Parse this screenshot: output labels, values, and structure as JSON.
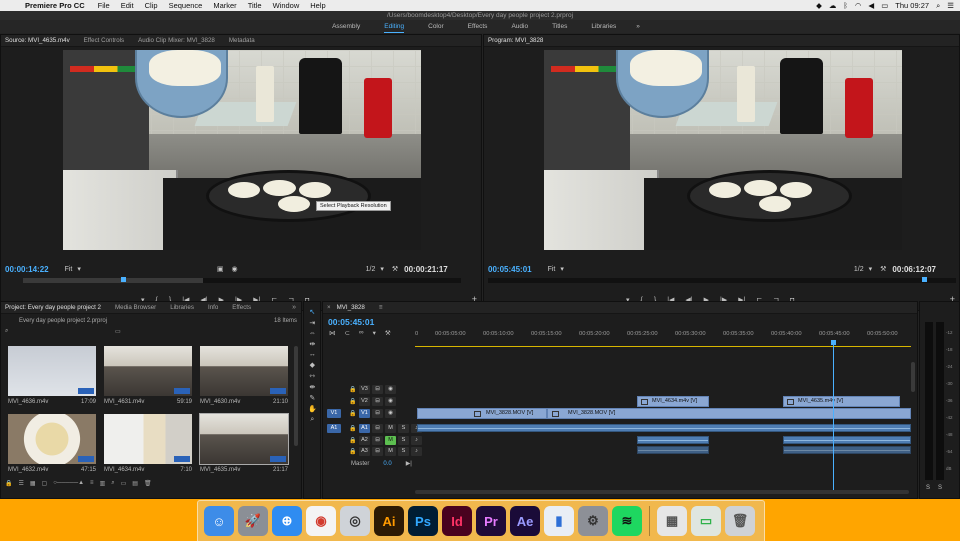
{
  "menubar": {
    "app_name": "Premiere Pro CC",
    "items": [
      "File",
      "Edit",
      "Clip",
      "Sequence",
      "Marker",
      "Title",
      "Window",
      "Help"
    ],
    "clock": "Thu 09:27"
  },
  "window": {
    "path": "/Users/boomdesktop4/Desktop/Every day people project 2.prproj"
  },
  "workspaces": {
    "items": [
      "Assembly",
      "Editing",
      "Color",
      "Effects",
      "Audio",
      "Titles",
      "Libraries"
    ],
    "active": "Editing",
    "more": "»"
  },
  "source": {
    "tabs": [
      "Source: MVI_4635.m4v",
      "Effect Controls",
      "Audio Clip Mixer: MVI_3828",
      "Metadata"
    ],
    "timecode": "00:00:14:22",
    "fit": "Fit",
    "resolution": "1/2",
    "duration": "00:00:21:17",
    "tooltip": "Select Playback Resolution"
  },
  "program": {
    "tabs": [
      "Program: MVI_3828"
    ],
    "timecode": "00:05:45:01",
    "fit": "Fit",
    "resolution": "1/2",
    "duration": "00:06:12:07"
  },
  "project": {
    "tabs": [
      "Project: Every day people project 2",
      "Media Browser",
      "Libraries",
      "Info",
      "Effects"
    ],
    "file": "Every day people project 2.prproj",
    "count": "18 Items",
    "items": [
      {
        "name": "MVI_4636.m4v",
        "dur": "17:09",
        "style": "th-white"
      },
      {
        "name": "MVI_4631.m4v",
        "dur": "59:19",
        "style": "th-kitchen"
      },
      {
        "name": "MVI_4630.m4v",
        "dur": "21:10",
        "style": "th-kitchen"
      },
      {
        "name": "MVI_4632.m4v",
        "dur": "47:15",
        "style": "th-plate"
      },
      {
        "name": "MVI_4634.m4v",
        "dur": "7:10",
        "style": "th-fridge"
      },
      {
        "name": "MVI_4635.m4v",
        "dur": "21:17",
        "style": "th-kitchen"
      }
    ]
  },
  "timeline": {
    "tab": "MVI_3828",
    "timecode": "00:05:45:01",
    "ruler": [
      "0",
      "00:05:05:00",
      "00:05:10:00",
      "00:05:15:00",
      "00:05:20:00",
      "00:05:25:00",
      "00:05:30:00",
      "00:05:35:00",
      "00:05:40:00",
      "00:05:45:00",
      "00:05:50:00"
    ],
    "tracks": {
      "v3": "V3",
      "v2": "V2",
      "v1": "V1",
      "a1": "A1",
      "a2": "A2",
      "a3": "A3",
      "src_v1": "V1",
      "src_a1": "A1",
      "master": "Master",
      "master_val": "0.0"
    },
    "clips": {
      "v2_a": "MVI_4634.m4v [V]",
      "v2_b": "MVI_4635.m4v [V]",
      "v1_a": "MVI_3828.MOV [V]",
      "v1_b": "MVI_3828.MOV [V]"
    },
    "meter_labels": [
      "S",
      "S"
    ],
    "db_scale": [
      "-12",
      "-18",
      "-24",
      "-30",
      "-36",
      "-42",
      "-48",
      "-54",
      "dB"
    ]
  },
  "dock": {
    "apps": [
      {
        "name": "Finder",
        "glyph": "☺",
        "bg": "#3d8ce8",
        "fg": "#fff"
      },
      {
        "name": "Launchpad",
        "glyph": "🚀",
        "bg": "#8b8f96",
        "fg": "#fff"
      },
      {
        "name": "Safari",
        "glyph": "⊕",
        "bg": "#2f8cf1",
        "fg": "#fff"
      },
      {
        "name": "Chrome",
        "glyph": "◉",
        "bg": "#f4f4f4",
        "fg": "#d23b2e"
      },
      {
        "name": "Screenshot",
        "glyph": "◎",
        "bg": "#cfd3d8",
        "fg": "#333"
      },
      {
        "name": "Illustrator",
        "glyph": "Ai",
        "bg": "#2c1a04",
        "fg": "#ff9a00"
      },
      {
        "name": "Photoshop",
        "glyph": "Ps",
        "bg": "#001d34",
        "fg": "#31a8ff"
      },
      {
        "name": "InDesign",
        "glyph": "Id",
        "bg": "#49021f",
        "fg": "#ff3366"
      },
      {
        "name": "Premiere Pro",
        "glyph": "Pr",
        "bg": "#1f0b38",
        "fg": "#e77bff"
      },
      {
        "name": "After Effects",
        "glyph": "Ae",
        "bg": "#1a0b38",
        "fg": "#9b9bff"
      },
      {
        "name": "Keynote",
        "glyph": "▮",
        "bg": "#e9eef5",
        "fg": "#2e6fd6"
      },
      {
        "name": "System Preferences",
        "glyph": "⚙",
        "bg": "#8d9097",
        "fg": "#333"
      },
      {
        "name": "Spotify",
        "glyph": "≋",
        "bg": "#1ed760",
        "fg": "#111"
      },
      {
        "name": "Photos",
        "glyph": "▦",
        "bg": "#e6e6e6",
        "fg": "#555"
      },
      {
        "name": "FaceTime",
        "glyph": "▭",
        "bg": "#dfe6e0",
        "fg": "#2fb24a"
      },
      {
        "name": "Trash",
        "glyph": "🗑",
        "bg": "#cfd2d6",
        "fg": "#555"
      }
    ]
  }
}
